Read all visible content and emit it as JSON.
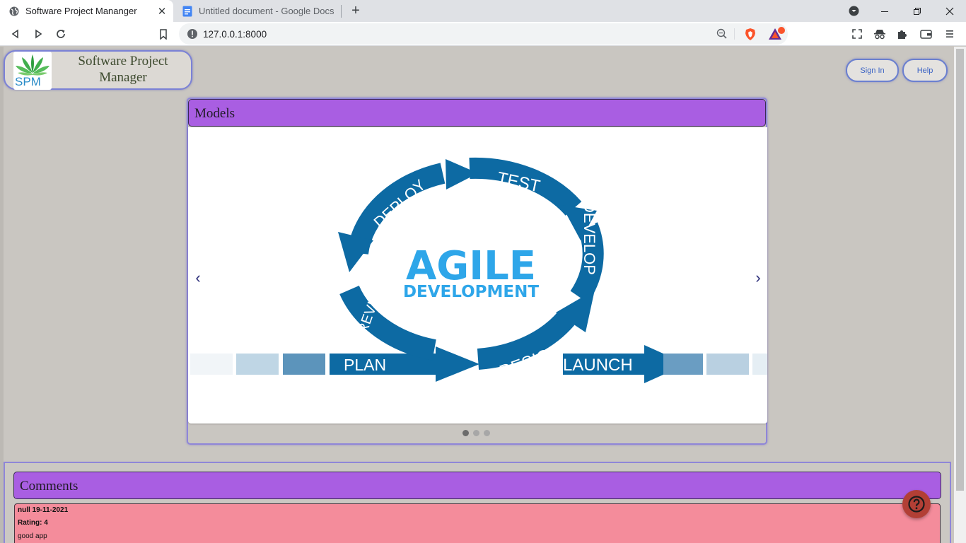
{
  "browser": {
    "tabs": [
      {
        "title": "Software Project Mananger",
        "icon": "globe-icon",
        "active": true
      },
      {
        "title": "Untitled document - Google Docs",
        "icon": "google-docs-icon",
        "active": false
      }
    ],
    "address": "127.0.0.1:8000"
  },
  "app": {
    "logo_text": "SPM",
    "name": "Software Project Manager",
    "nav": {
      "sign_in": "Sign In",
      "help": "Help"
    }
  },
  "models": {
    "header": "Models",
    "slide": {
      "title": "AGILE",
      "subtitle": "DEVELOPMENT",
      "stages": [
        "DEPLOY",
        "TEST",
        "DEVELOP",
        "DESIGN",
        "REVIEW",
        "PLAN",
        "LAUNCH"
      ]
    },
    "prev": "‹",
    "next": "›",
    "dots": 3,
    "active_dot": 0
  },
  "comments": {
    "header": "Comments",
    "items": [
      {
        "meta": "null 19-11-2021",
        "rating": "Rating: 4",
        "text": "good app"
      }
    ]
  },
  "colors": {
    "header_purple": "#a95ee2",
    "comment_pink": "#f48c9b",
    "agile_blue": "#0d6aa3",
    "agile_light_blue": "#2ea6e9",
    "fab_red": "#b23f35"
  }
}
